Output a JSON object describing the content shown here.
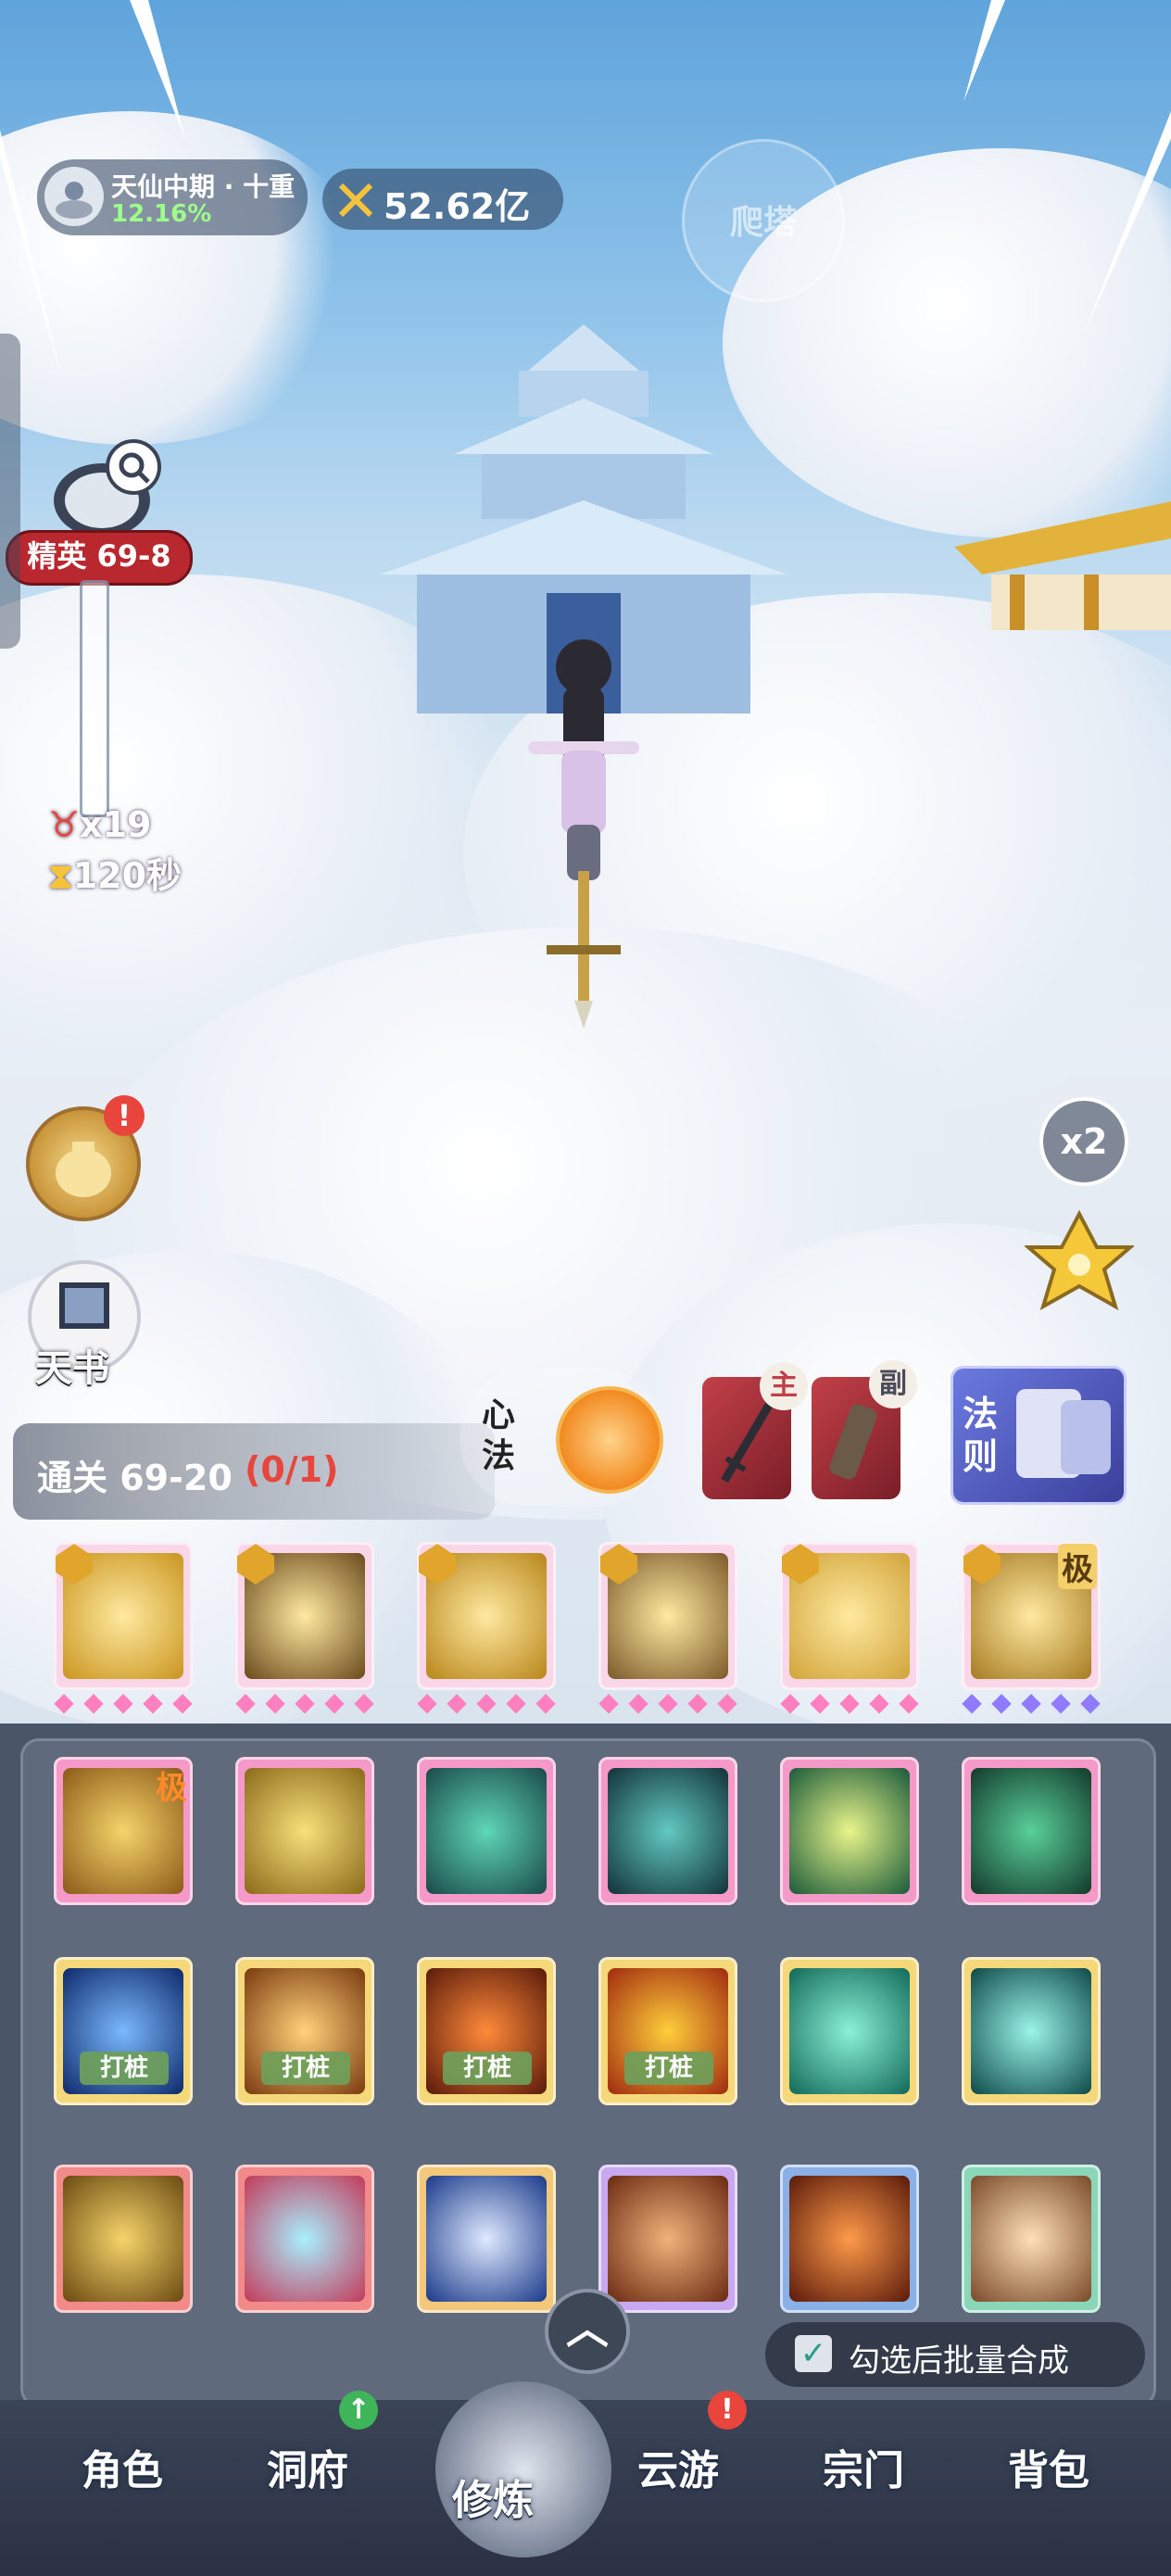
{
  "hud": {
    "realm_name": "天仙中期 · 十重",
    "realm_progress": "12.16%",
    "power_value": "52.62亿",
    "tower_label": "爬塔"
  },
  "stage": {
    "elite_label": "精英 69-8",
    "enemy_count": "x19",
    "time_left": "120秒",
    "clear_label": "通关 69-20",
    "clear_progress": "(0/1)"
  },
  "side": {
    "tianshu_label": "天书",
    "speed_label": "x2"
  },
  "equip": {
    "xinfa_label": "心法",
    "main_label": "主",
    "sub_label": "副",
    "faze_label": "法则"
  },
  "skills": {
    "row1": [
      {
        "badge": "sword",
        "stars": 5,
        "star_color": "#ff7fbf",
        "art": "#c9951f"
      },
      {
        "badge": "sword",
        "stars": 5,
        "star_color": "#ff7fbf",
        "art": "#6a4a1c"
      },
      {
        "badge": "sword",
        "stars": 5,
        "star_color": "#ff7fbf",
        "art": "#b8861a"
      },
      {
        "badge": "sword",
        "stars": 5,
        "star_color": "#ff7fbf",
        "art": "#7a5a2a"
      },
      {
        "badge": "sword",
        "stars": 5,
        "star_color": "#ff7fbf",
        "art": "#d1a43a"
      },
      {
        "badge": "sword",
        "stars": 5,
        "star_color": "#8f7bff",
        "art": "#a67b22",
        "extreme": "极"
      }
    ],
    "row2_extreme": "极",
    "tag_label": "打桩",
    "batch_label": "勾选后批量合成"
  },
  "nav": {
    "items": [
      "角色",
      "洞府",
      "修炼",
      "云游",
      "宗门",
      "背包"
    ]
  },
  "colors": {
    "gold": "#e8b832",
    "alert_red": "#e8453c",
    "elite_red": "#b8282e"
  }
}
